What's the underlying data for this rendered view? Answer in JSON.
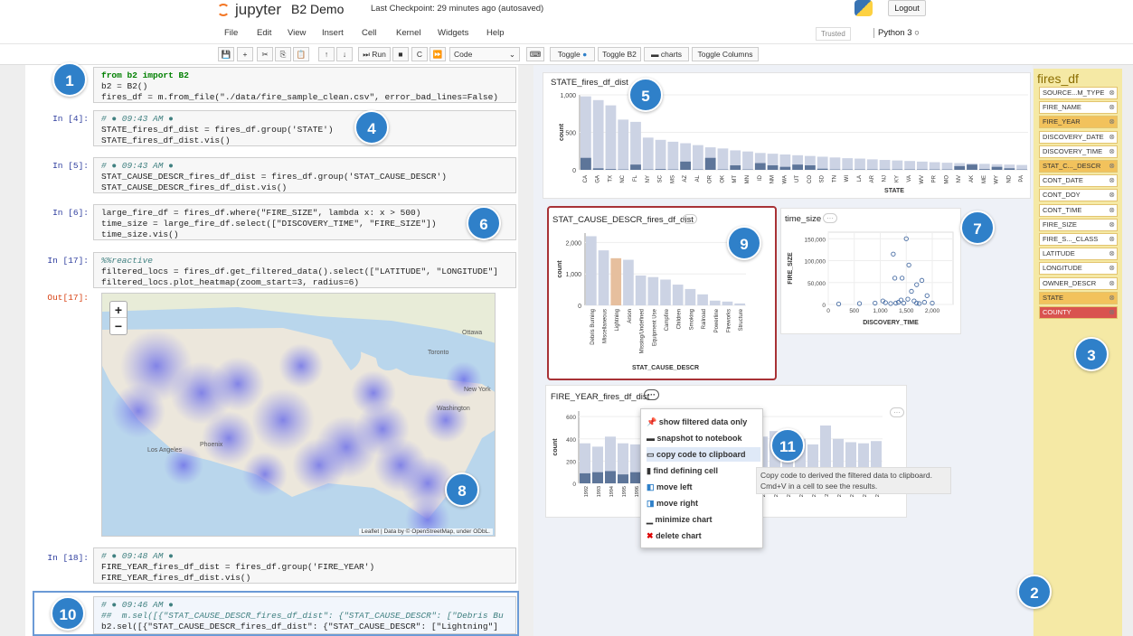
{
  "header": {
    "brand": "jupyter",
    "notebook_title": "B2 Demo",
    "checkpoint": "Last Checkpoint: 29 minutes ago  (autosaved)",
    "logout_label": "Logout",
    "trusted_label": "Trusted",
    "kernel_label": "Python 3"
  },
  "menu": [
    "File",
    "Edit",
    "View",
    "Insert",
    "Cell",
    "Kernel",
    "Widgets",
    "Help"
  ],
  "toolbar": {
    "run_label": "Run",
    "cell_type": "Code",
    "toggle_label": "Toggle",
    "toggle_b2_label": "Toggle B2",
    "charts_label": "charts",
    "toggle_columns_label": "Toggle Columns"
  },
  "cells": {
    "c1": {
      "prompt": "",
      "line1": "from b2 import B2",
      "line2": "b2 = B2()",
      "line3": "fires_df = m.from_file(\"./data/fire_sample_clean.csv\", error_bad_lines=False)"
    },
    "c2": {
      "prompt": "In [4]:",
      "meta": "# ● 09:43 AM ●",
      "line1": "STATE_fires_df_dist = fires_df.group('STATE')",
      "line2": "STATE_fires_df_dist.vis()"
    },
    "c3": {
      "prompt": "In [5]:",
      "meta": "# ● 09:43 AM ●",
      "line1": "STAT_CAUSE_DESCR_fires_df_dist = fires_df.group('STAT_CAUSE_DESCR')",
      "line2": "STAT_CAUSE_DESCR_fires_df_dist.vis()"
    },
    "c4": {
      "prompt": "In [6]:",
      "line1": "large_fire_df = fires_df.where(\"FIRE_SIZE\", lambda x: x > 500)",
      "line2": "time_size = large_fire_df.select([\"DISCOVERY_TIME\", \"FIRE_SIZE\"])",
      "line3": "time_size.vis()"
    },
    "c5": {
      "prompt": "In [17]:",
      "line1": "%%reactive",
      "line2": "filtered_locs = fires_df.get_filtered_data().select([\"LATITUDE\", \"LONGITUDE\"]",
      "line3": "filtered_locs.plot_heatmap(zoom_start=3, radius=6)"
    },
    "out17": {
      "prompt": "Out[17]:"
    },
    "c6": {
      "prompt": "In [18]:",
      "meta": "# ● 09:48 AM ●",
      "line1": "FIRE_YEAR_fires_df_dist = fires_df.group('FIRE_YEAR')",
      "line2": "FIRE_YEAR_fires_df_dist.vis()"
    },
    "c7": {
      "prompt": "",
      "meta": "# ● 09:46 AM ●",
      "line1": "##  m.sel([{\"STAT_CAUSE_DESCR_fires_df_dist\": {\"STAT_CAUSE_DESCR\": [\"Debris Bu",
      "line2": "b2.sel([{\"STAT_CAUSE_DESCR_fires_df_dist\": {\"STAT_CAUSE_DESCR\": [\"Lightning\"]"
    }
  },
  "map": {
    "zoom_in": "+",
    "zoom_out": "−",
    "attribution": "Leaflet | Data by © OpenStreetMap, under ODbL.",
    "cities": [
      "Ottawa",
      "Toronto",
      "New York",
      "Washington",
      "Los Angeles",
      "Phoenix"
    ]
  },
  "badges": [
    "1",
    "2",
    "3",
    "4",
    "5",
    "6",
    "7",
    "8",
    "9",
    "10",
    "11"
  ],
  "fields": {
    "title": "fires_df",
    "items": [
      {
        "label": "SOURCE...M_TYPE",
        "state": "normal"
      },
      {
        "label": "FIRE_NAME",
        "state": "normal"
      },
      {
        "label": "FIRE_YEAR",
        "state": "selected"
      },
      {
        "label": "DISCOVERY_DATE",
        "state": "normal"
      },
      {
        "label": "DISCOVERY_TIME",
        "state": "normal"
      },
      {
        "label": "STAT_C..._DESCR",
        "state": "selected"
      },
      {
        "label": "CONT_DATE",
        "state": "normal"
      },
      {
        "label": "CONT_DOY",
        "state": "normal"
      },
      {
        "label": "CONT_TIME",
        "state": "normal"
      },
      {
        "label": "FIRE_SIZE",
        "state": "normal"
      },
      {
        "label": "FIRE_S..._CLASS",
        "state": "normal"
      },
      {
        "label": "LATITUDE",
        "state": "normal"
      },
      {
        "label": "LONGITUDE",
        "state": "normal"
      },
      {
        "label": "OWNER_DESCR",
        "state": "normal"
      },
      {
        "label": "STATE",
        "state": "selected"
      },
      {
        "label": "COUNTY",
        "state": "red"
      }
    ]
  },
  "context_menu": {
    "items": [
      {
        "icon": "pin-icon",
        "label": "show filtered data only"
      },
      {
        "icon": "camera-icon",
        "label": "snapshot to notebook"
      },
      {
        "icon": "clipboard-icon",
        "label": "copy code to clipboard"
      },
      {
        "icon": "bars-icon",
        "label": "find defining cell"
      },
      {
        "icon": "move-left-icon",
        "label": "move left"
      },
      {
        "icon": "move-right-icon",
        "label": "move right"
      },
      {
        "icon": "minimize-icon",
        "label": "minimize chart"
      },
      {
        "icon": "delete-icon",
        "label": "delete chart"
      }
    ],
    "tooltip": "Copy code to derived the filtered data to clipboard. Cmd+V in a cell to see the results."
  },
  "chart_data": [
    {
      "type": "bar",
      "title": "STATE_fires_df_dist",
      "xlabel": "STATE",
      "ylabel": "count",
      "ylim": [
        0,
        1000
      ],
      "yticks": [
        "1,000",
        "500",
        "0"
      ],
      "categories": [
        "CA",
        "GA",
        "TX",
        "NC",
        "FL",
        "NY",
        "SC",
        "MS",
        "AZ",
        "AL",
        "OR",
        "OK",
        "MT",
        "MN",
        "ID",
        "NM",
        "WA",
        "UT",
        "CO",
        "SD",
        "TN",
        "WI",
        "LA",
        "AR",
        "NJ",
        "KY",
        "VA",
        "WV",
        "PR",
        "MO",
        "NV",
        "AK",
        "ME",
        "WY",
        "ND",
        "PA"
      ],
      "series": [
        {
          "name": "all",
          "values": [
            980,
            930,
            860,
            670,
            640,
            430,
            400,
            375,
            355,
            330,
            300,
            285,
            260,
            245,
            225,
            215,
            205,
            195,
            185,
            175,
            165,
            155,
            150,
            140,
            132,
            125,
            118,
            110,
            102,
            95,
            90,
            85,
            80,
            75,
            70,
            65
          ]
        },
        {
          "name": "filtered",
          "values": [
            160,
            20,
            10,
            5,
            70,
            5,
            10,
            5,
            110,
            5,
            160,
            5,
            60,
            5,
            90,
            60,
            40,
            70,
            60,
            15,
            5,
            5,
            5,
            5,
            5,
            5,
            5,
            5,
            5,
            5,
            50,
            70,
            10,
            40,
            20,
            5
          ]
        }
      ]
    },
    {
      "type": "bar",
      "title": "STAT_CAUSE_DESCR_fires_df_dist",
      "xlabel": "STAT_CAUSE_DESCR",
      "ylabel": "count",
      "ylim": [
        0,
        2300
      ],
      "yticks": [
        "2,000",
        "1,000",
        "0"
      ],
      "categories": [
        "Debris Burning",
        "Miscellaneous",
        "Lightning",
        "Arson",
        "Missing/Undefined",
        "Equipment Use",
        "Campfire",
        "Children",
        "Smoking",
        "Railroad",
        "Powerline",
        "Fireworks",
        "Structure"
      ],
      "values": [
        2200,
        1750,
        1500,
        1450,
        950,
        900,
        820,
        660,
        520,
        350,
        150,
        120,
        60
      ],
      "highlight": "Lightning"
    },
    {
      "type": "scatter",
      "title": "time_size",
      "xlabel": "DISCOVERY_TIME",
      "ylabel": "FIRE_SIZE",
      "xlim": [
        0,
        2400
      ],
      "ylim": [
        0,
        165000
      ],
      "xticks": [
        "0",
        "500",
        "1,000",
        "1,500",
        "2,000"
      ],
      "yticks": [
        "150,000",
        "100,000",
        "50,000",
        "0"
      ],
      "points": [
        [
          200,
          1000
        ],
        [
          600,
          2000
        ],
        [
          900,
          3000
        ],
        [
          1050,
          8000
        ],
        [
          1100,
          4000
        ],
        [
          1200,
          2000
        ],
        [
          1250,
          115000
        ],
        [
          1280,
          60000
        ],
        [
          1300,
          3000
        ],
        [
          1350,
          5000
        ],
        [
          1400,
          10000
        ],
        [
          1450,
          3000
        ],
        [
          1500,
          150000
        ],
        [
          1550,
          90000
        ],
        [
          1600,
          30000
        ],
        [
          1650,
          8000
        ],
        [
          1700,
          45000
        ],
        [
          1750,
          2000
        ],
        [
          1800,
          55000
        ],
        [
          1850,
          5000
        ],
        [
          1900,
          20000
        ],
        [
          2000,
          3000
        ],
        [
          1700,
          3000
        ],
        [
          1420,
          60000
        ],
        [
          1530,
          12000
        ]
      ]
    },
    {
      "type": "bar",
      "title": "FIRE_YEAR_fires_df_dist",
      "xlabel": "",
      "ylabel": "count",
      "ylim": [
        0,
        650
      ],
      "yticks": [
        "600",
        "400",
        "200",
        "0"
      ],
      "categories": [
        "1992",
        "1993",
        "1994",
        "1995",
        "1996",
        "1997",
        "1998",
        "1999",
        "2000",
        "2001",
        "2002",
        "2003",
        "2004",
        "2005",
        "2006",
        "2007",
        "2008",
        "2009",
        "2010",
        "2011",
        "2012",
        "2013",
        "2014",
        "2015"
      ],
      "series": [
        {
          "name": "all",
          "values": [
            360,
            330,
            420,
            360,
            350,
            300,
            320,
            340,
            420,
            370,
            380,
            330,
            290,
            400,
            420,
            470,
            420,
            400,
            350,
            520,
            400,
            370,
            360,
            380
          ]
        },
        {
          "name": "filtered",
          "values": [
            90,
            100,
            110,
            80,
            100,
            80,
            90,
            70,
            100,
            90,
            80,
            70,
            60,
            90,
            80,
            100,
            90,
            70,
            80,
            100,
            70,
            60,
            60,
            70
          ]
        }
      ]
    }
  ]
}
